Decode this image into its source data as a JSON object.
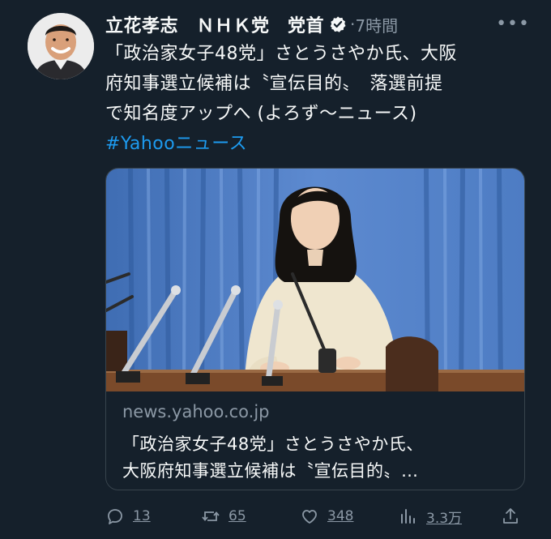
{
  "tweet": {
    "author_name": "立花孝志　ＮＨＫ党　党首",
    "timestamp": "7時間",
    "more_icon": "more-icon",
    "text_lines": [
      "「政治家女子48党」さとうさやか氏、大阪",
      "府知事選立候補は〝宣伝目的〟　落選前提",
      "で知名度アップへ (よろず〜ニュース)"
    ],
    "hashtag": "#Yahooニュース"
  },
  "card": {
    "domain": "news.yahoo.co.jp",
    "title_lines": [
      "「政治家女子48党」さとうさやか氏、",
      "大阪府知事選立候補は〝宣伝目的〟…"
    ]
  },
  "actions": {
    "reply_count": "13",
    "retweet_count": "65",
    "like_count": "348",
    "views_count": "3.3万",
    "icons": [
      "reply-icon",
      "retweet-icon",
      "like-icon",
      "views-icon",
      "share-icon"
    ]
  },
  "colors": {
    "background": "#15202b",
    "text": "#f7f9f9",
    "secondary": "#8b98a5",
    "accent": "#1d9bf0",
    "border": "#38444d"
  }
}
